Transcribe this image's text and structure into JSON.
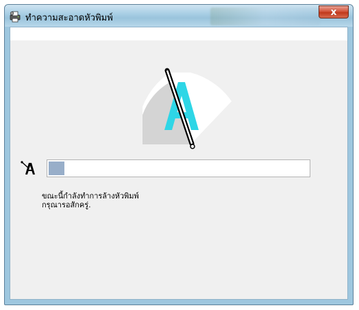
{
  "window": {
    "title": "ทำความสะอาดหัวพิมพ์",
    "close_glyph": "x"
  },
  "icons": {
    "app": "printer-icon",
    "wiper": "wiper-blade-icon",
    "print_head": "print-head-icon"
  },
  "progress": {
    "fraction": 0.06,
    "fill_color": "#98aec9"
  },
  "status": {
    "line1": "ขณะนี้กำลังทำการล้างหัวพิมพ์",
    "line2": "กรุณารอสักครู่."
  },
  "colors": {
    "accent_cyan": "#2ed6e6",
    "close_red": "#c7432a"
  }
}
